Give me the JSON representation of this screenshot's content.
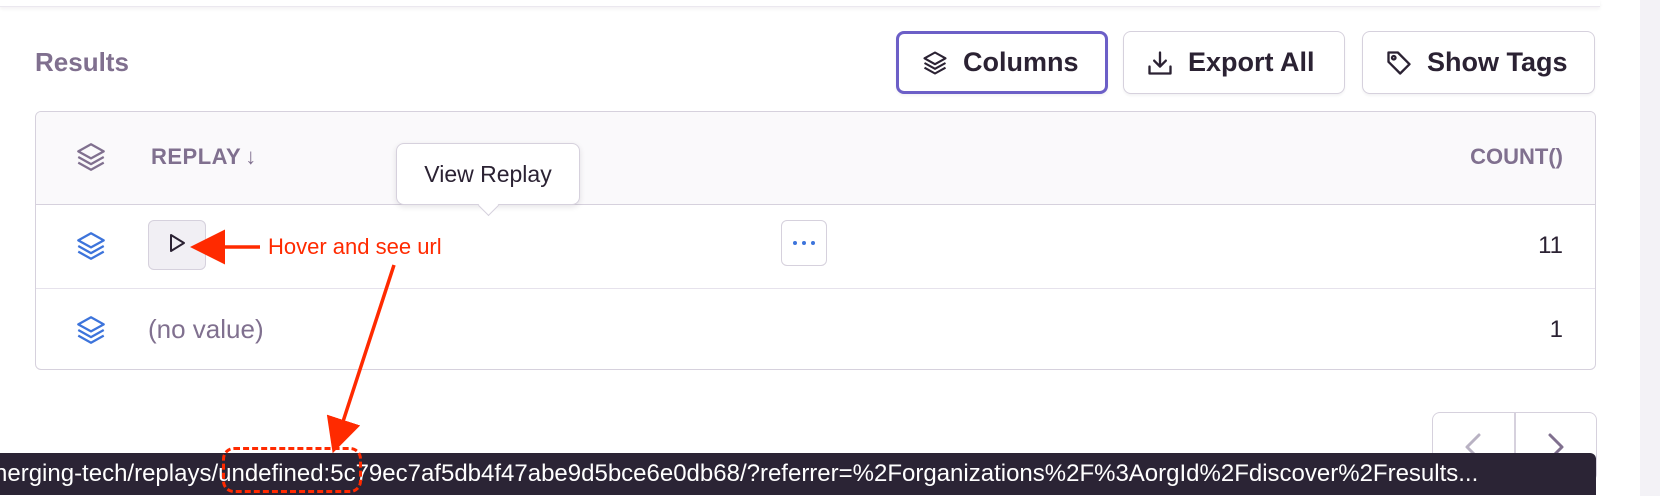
{
  "results_label": "Results",
  "toolbar": {
    "columns_label": "Columns",
    "export_label": "Export All",
    "tags_label": "Show Tags"
  },
  "table": {
    "headers": {
      "replay": "REPLAY",
      "sort_arrow": "↓",
      "count": "COUNT()"
    },
    "rows": [
      {
        "replay": "",
        "count": "11"
      },
      {
        "replay": "(no value)",
        "count": "1"
      }
    ]
  },
  "tooltip": "View Replay",
  "annotation": "Hover and see url",
  "status_url": "nerging-tech/replays/undefined:5c79ec7af5db4f47abe9d5bce6e0db68/?referrer=%2Forganizations%2F%3AorgId%2Fdiscover%2Fresults...",
  "colors": {
    "accent": "#6c5fc7",
    "icon_blue": "#3d74db",
    "annotation_red": "#ff2a00",
    "muted_text": "#80708f"
  }
}
